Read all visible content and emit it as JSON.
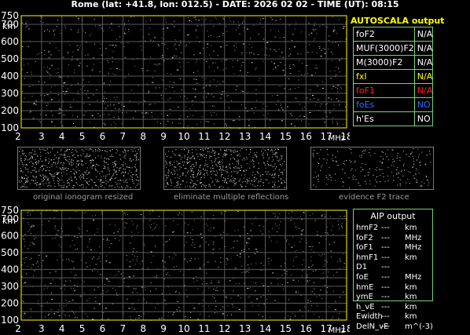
{
  "header": {
    "title": "Rome (lat: +41.8, lon: 012.5) - DATE: 2026 02 02 - TIME (UT): 08:15"
  },
  "ionogram_top": {
    "y_unit": "km",
    "y_ticks": [
      "750",
      "700",
      "600",
      "500",
      "400",
      "300",
      "200",
      "100"
    ],
    "x_ticks": [
      "2",
      "3",
      "4",
      "5",
      "6",
      "7",
      "8",
      "9",
      "10",
      "11",
      "12",
      "13",
      "14",
      "15",
      "16",
      "17",
      "18"
    ],
    "x_unit": "MHz"
  },
  "ionogram_bottom": {
    "y_unit": "km",
    "y_ticks": [
      "750",
      "700",
      "600",
      "500",
      "400",
      "300",
      "200",
      "100"
    ],
    "x_ticks": [
      "2",
      "3",
      "4",
      "5",
      "6",
      "7",
      "8",
      "9",
      "10",
      "11",
      "12",
      "13",
      "14",
      "15",
      "16",
      "17",
      "18"
    ],
    "x_unit": "MHz"
  },
  "thumbnails": {
    "original": "original ionogram resized",
    "multiple": "eliminate multiple reflections",
    "f2trace": "evidence F2 trace"
  },
  "autoscala": {
    "title": "AUTOSCALA output",
    "rows": [
      {
        "label": "foF2",
        "value": "N/A",
        "color": "#ffffff"
      },
      {
        "label": "MUF(3000)F2",
        "value": "N/A",
        "color": "#ffffff"
      },
      {
        "label": "M(3000)F2",
        "value": "N/A",
        "color": "#ffffff"
      },
      {
        "label": "fxI",
        "value": "N/A",
        "color": "#ffff00"
      },
      {
        "label": "foF1",
        "value": "N/A",
        "color": "#ff2020"
      },
      {
        "label": "foEs",
        "value": "NO",
        "color": "#2f6bff"
      },
      {
        "label": "h'Es",
        "value": "NO",
        "color": "#ffffff"
      }
    ]
  },
  "aip": {
    "title": "AIP output",
    "rows": [
      {
        "label": "hmF2",
        "value": "---",
        "unit": "km"
      },
      {
        "label": "foF2",
        "value": "---",
        "unit": "MHz"
      },
      {
        "label": "foF1",
        "value": "---",
        "unit": "MHz"
      },
      {
        "label": "hmF1",
        "value": "---",
        "unit": "km"
      },
      {
        "label": "D1",
        "value": "---",
        "unit": ""
      },
      {
        "label": "foE",
        "value": "---",
        "unit": "MHz"
      },
      {
        "label": "hmE",
        "value": "---",
        "unit": "km"
      },
      {
        "label": "ymE",
        "value": "---",
        "unit": "km"
      },
      {
        "label": "h_vE",
        "value": "---",
        "unit": "km"
      },
      {
        "label": "Ewidth",
        "value": "---",
        "unit": "km"
      },
      {
        "label": "DelN_vE",
        "value": "---",
        "unit": "m^(-3)"
      }
    ]
  },
  "colors": {
    "frame": "#ffff00",
    "grid": "#5a5a5a",
    "table_border": "#7ccf7c",
    "caption": "#9a9a9a"
  }
}
